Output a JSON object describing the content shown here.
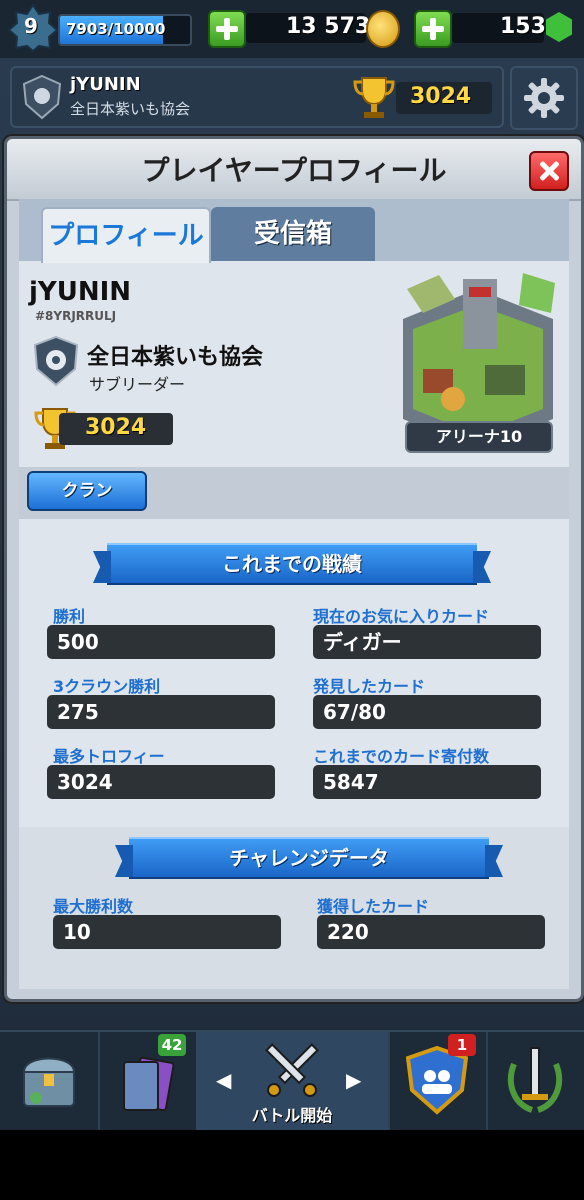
{
  "header": {
    "level": "9",
    "xp_text": "7903/10000",
    "xp_progress": 0.79,
    "gold": "13 573",
    "gems": "153"
  },
  "player_bar": {
    "name": "jYUNIN",
    "clan": "全日本紫いも協会",
    "trophies": "3024"
  },
  "modal": {
    "title": "プレイヤープロフィール",
    "tabs": [
      {
        "label": "プロフィール",
        "active": true
      },
      {
        "label": "受信箱",
        "active": false
      }
    ],
    "profile": {
      "name": "jYUNIN",
      "tag": "#8YRJRRULJ",
      "clan_name": "全日本紫いも協会",
      "clan_role": "サブリーダー",
      "trophies": "3024",
      "arena_label": "アリーナ10",
      "clan_button": "クラン"
    },
    "stats_title": "これまでの戦績",
    "stats": [
      {
        "label": "勝利",
        "value": "500"
      },
      {
        "label": "現在のお気に入りカード",
        "value": "ディガー"
      },
      {
        "label": "3クラウン勝利",
        "value": "275"
      },
      {
        "label": "発見したカード",
        "value": "67/80"
      },
      {
        "label": "最多トロフィー",
        "value": "3024"
      },
      {
        "label": "これまでのカード寄付数",
        "value": "5847"
      }
    ],
    "challenge_title": "チャレンジデータ",
    "challenge": [
      {
        "label": "最大勝利数",
        "value": "10"
      },
      {
        "label": "獲得したカード",
        "value": "220"
      }
    ]
  },
  "bottom_nav": {
    "cards_badge": "42",
    "clan_badge": "1",
    "battle_label": "バトル開始"
  }
}
